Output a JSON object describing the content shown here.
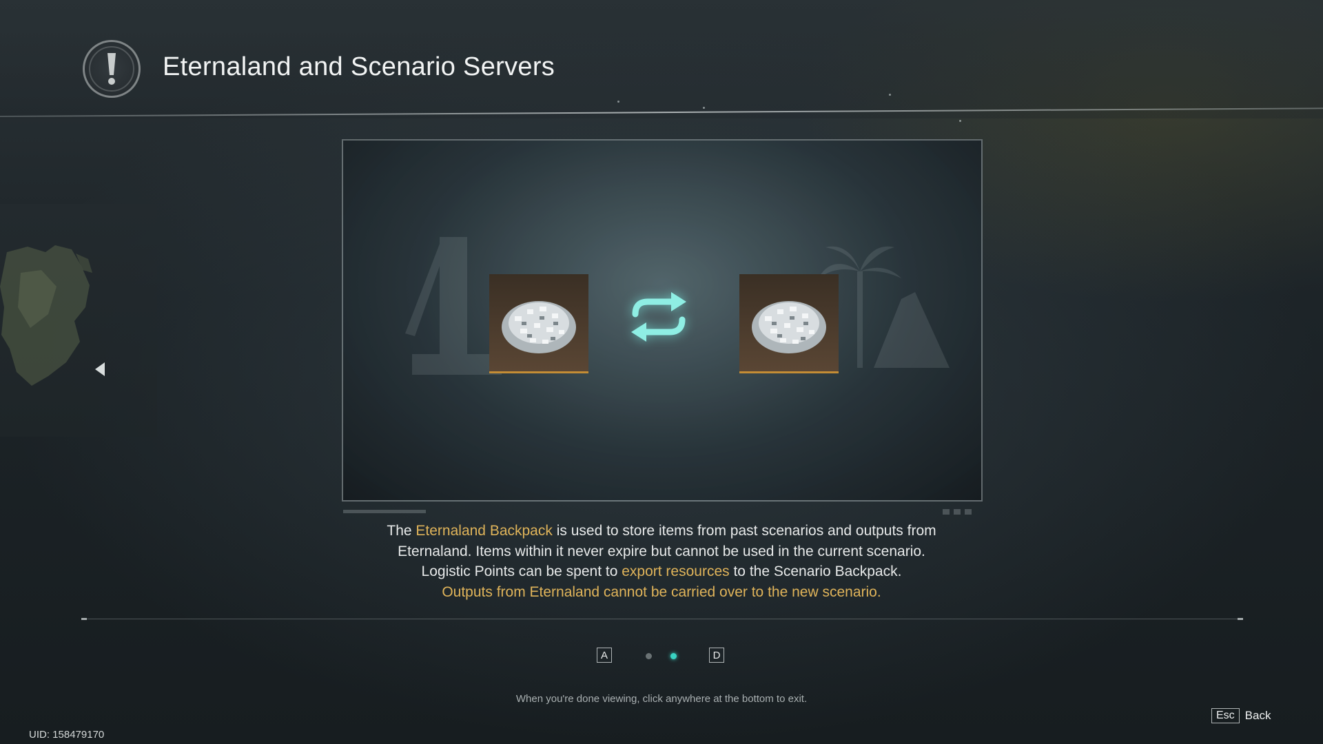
{
  "header": {
    "title": "Eternaland and Scenario Servers",
    "icon": "exclamation-icon"
  },
  "picture": {
    "left_item_icon": "silver-ore-pile-icon",
    "right_item_icon": "silver-ore-pile-icon",
    "center_icon": "swap-arrows-icon",
    "accent_color": "#c48d35",
    "glow_color": "#7fe6dc"
  },
  "description": {
    "line1_pre": "The ",
    "line1_hl": "Eternaland Backpack",
    "line1_post": " is used to store items from past scenarios and outputs from",
    "line2": "Eternaland. Items within it never expire but cannot be used in the current scenario.",
    "line3_pre": "Logistic Points can be spent to ",
    "line3_hl": "export resources",
    "line3_post": " to the Scenario Backpack.",
    "line4_hl": "Outputs from Eternaland cannot be carried over to the new scenario.",
    "highlight_color": "#e0b45a"
  },
  "pager": {
    "prev_key": "A",
    "next_key": "D",
    "page_count": 2,
    "current_page": 2,
    "active_color": "#39d3c2"
  },
  "footer": {
    "hint": "When you're done viewing, click anywhere at the bottom to exit.",
    "uid": "UID: 158479170",
    "esc_key": "Esc",
    "back_label": "Back"
  }
}
